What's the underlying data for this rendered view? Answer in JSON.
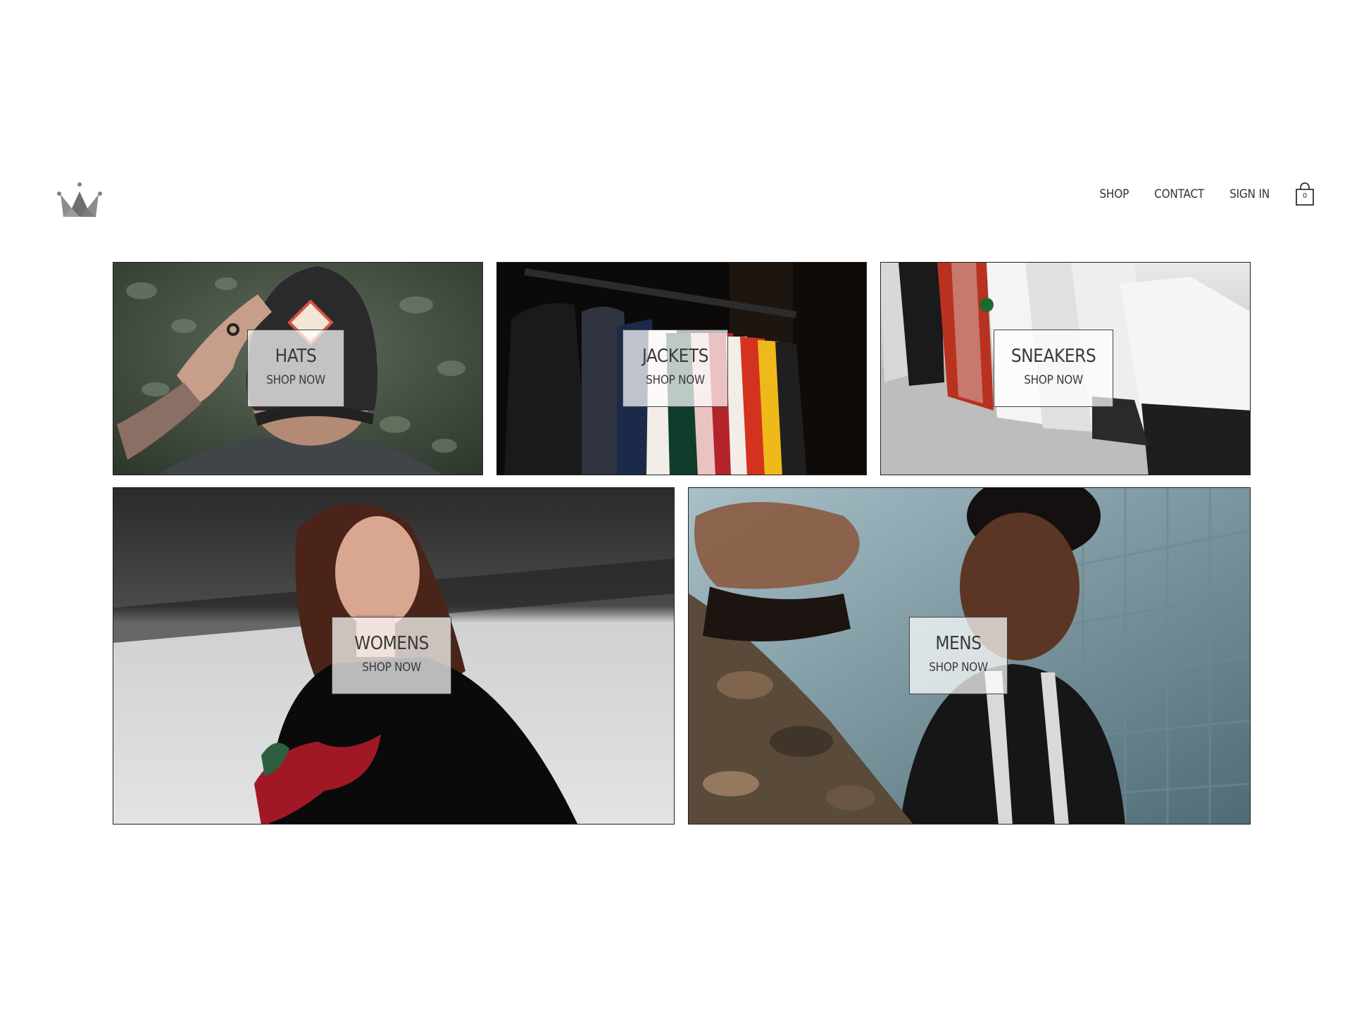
{
  "header": {
    "logo_icon": "crown-icon",
    "nav": [
      {
        "label": "SHOP"
      },
      {
        "label": "CONTACT"
      },
      {
        "label": "SIGN IN"
      }
    ],
    "cart": {
      "icon": "shopping-bag-icon",
      "count": "0"
    }
  },
  "directory": {
    "sections": [
      {
        "title": "HATS",
        "subtitle": "SHOP NOW"
      },
      {
        "title": "JACKETS",
        "subtitle": "SHOP NOW"
      },
      {
        "title": "SNEAKERS",
        "subtitle": "SHOP NOW"
      },
      {
        "title": "WOMENS",
        "subtitle": "SHOP NOW"
      },
      {
        "title": "MENS",
        "subtitle": "SHOP NOW"
      }
    ]
  },
  "colors": {
    "text": "#333333",
    "border": "#222222",
    "logo": "#808080"
  }
}
